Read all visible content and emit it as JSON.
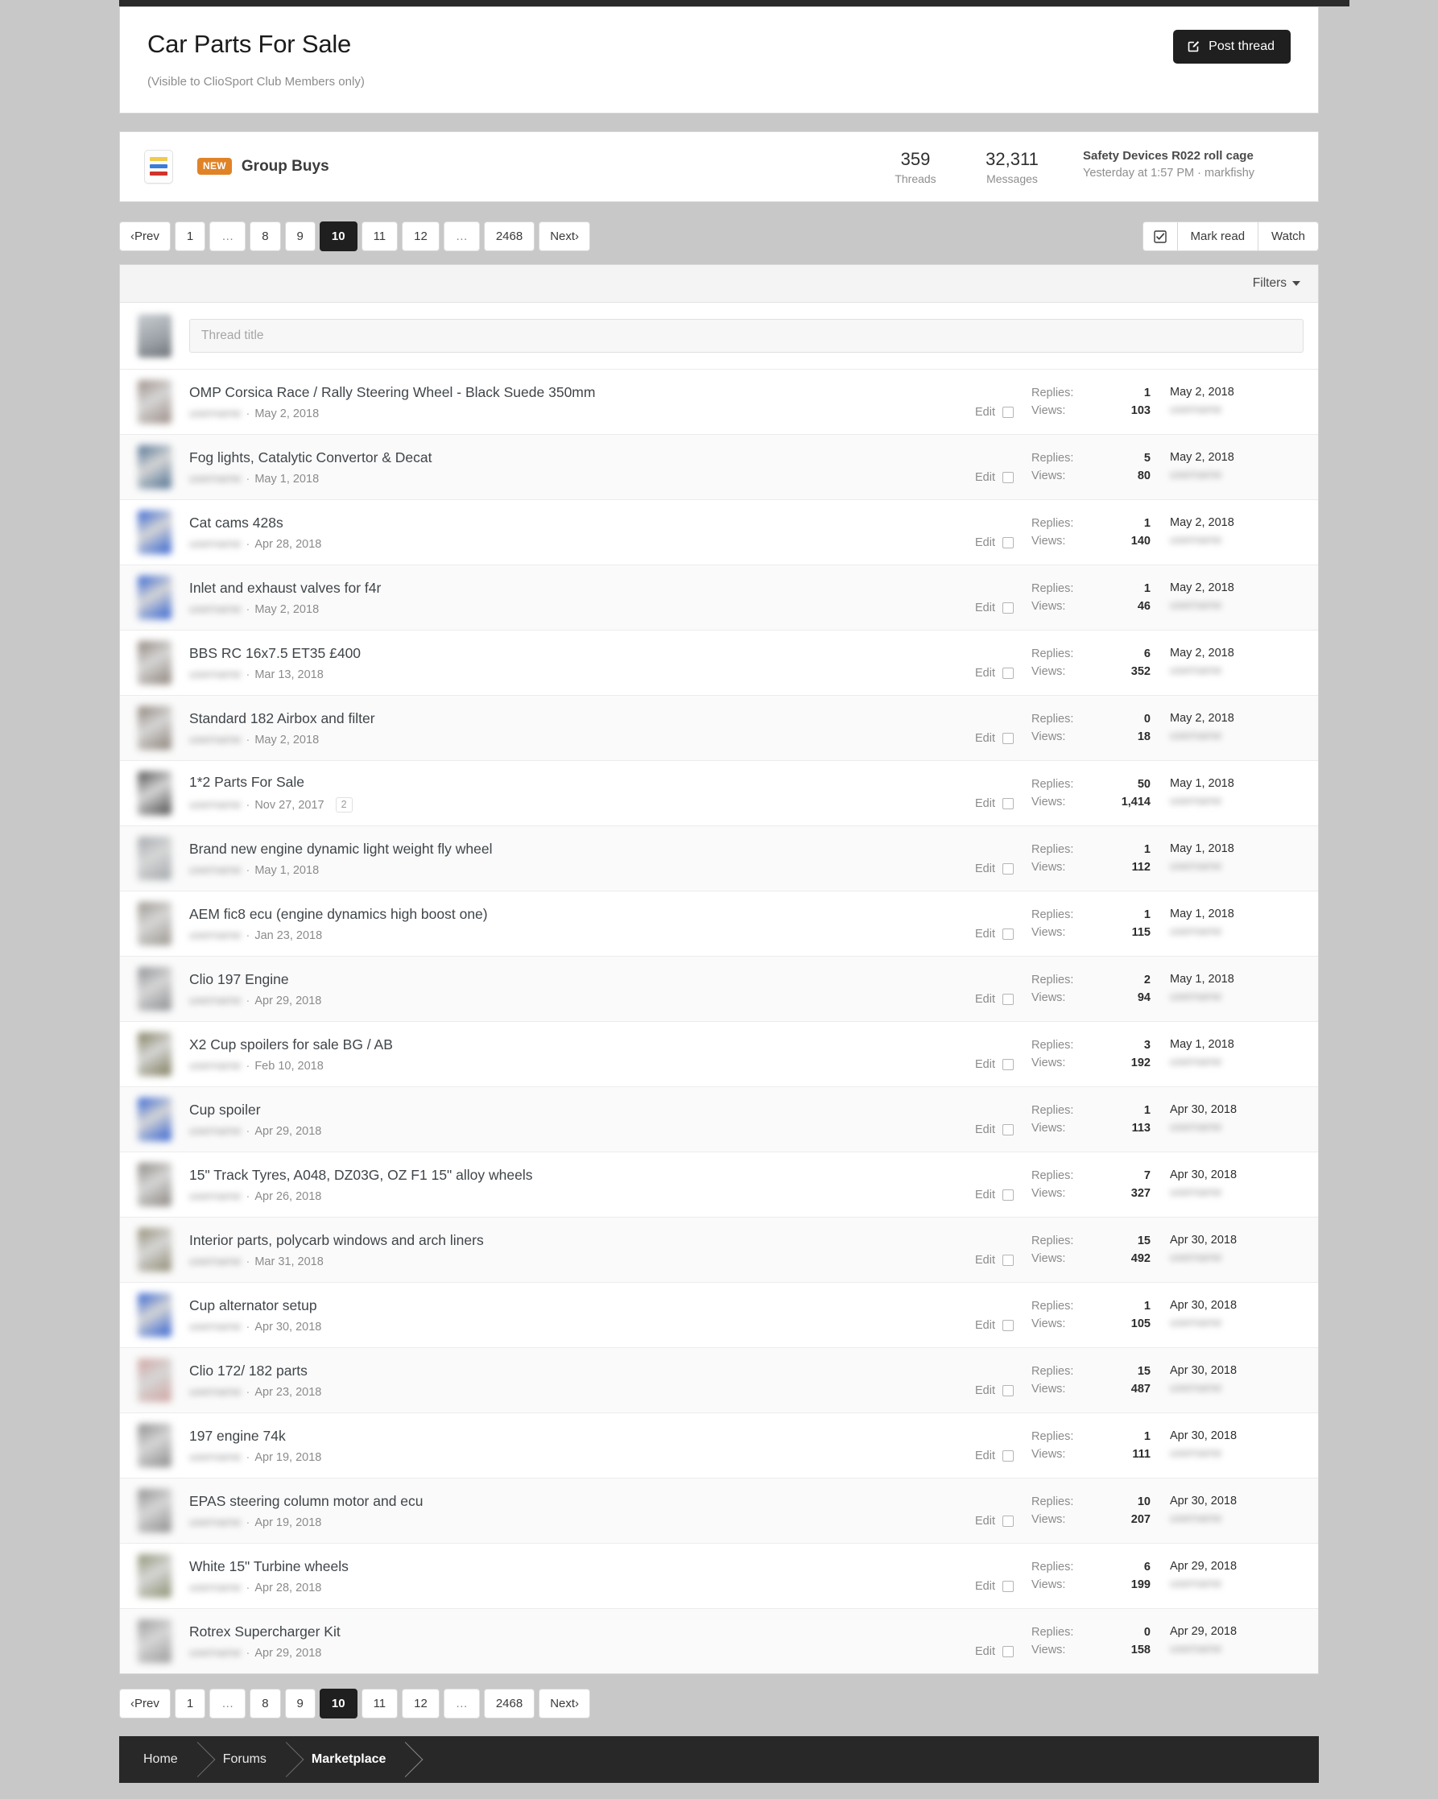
{
  "header": {
    "title": "Car Parts For Sale",
    "subtitle": "(Visible to ClioSport Club Members only)",
    "post_thread_label": "Post thread",
    "post_thread_icon": "pencil-square-icon"
  },
  "node": {
    "icon": "forum-node-icon",
    "badge": "NEW",
    "title": "Group Buys",
    "threads_count": "359",
    "threads_label": "Threads",
    "messages_count": "32,311",
    "messages_label": "Messages",
    "last_post_title": "Safety Devices R022 roll cage",
    "last_post_meta": "Yesterday at 1:57 PM · markfishy"
  },
  "pagination": {
    "prev": "‹Prev",
    "next": "Next›",
    "pages": [
      "1",
      "…",
      "8",
      "9",
      "10",
      "11",
      "12",
      "…",
      "2468"
    ],
    "current": "10"
  },
  "actions": {
    "mark_read": "Mark read",
    "watch": "Watch",
    "checkbox_icon": "checked-box-icon"
  },
  "list": {
    "filters_label": "Filters",
    "search_placeholder": "Thread title",
    "search_value": "",
    "edit_label": "Edit",
    "replies_label": "Replies:",
    "views_label": "Views:"
  },
  "threads": [
    {
      "title": "OMP Corsica Race / Rally Steering Wheel - Black Suede 350mm",
      "date": "May 2, 2018",
      "replies": "1",
      "views": "103",
      "last_date": "May 2, 2018",
      "av": "#9a8b84",
      "pages": ""
    },
    {
      "title": "Fog lights, Catalytic Convertor & Decat",
      "date": "May 1, 2018",
      "replies": "5",
      "views": "80",
      "last_date": "May 2, 2018",
      "av": "#4b6d8f",
      "pages": ""
    },
    {
      "title": "Cat cams 428s",
      "date": "Apr 28, 2018",
      "replies": "1",
      "views": "140",
      "last_date": "May 2, 2018",
      "av": "#2f5fd0",
      "pages": ""
    },
    {
      "title": "Inlet and exhaust valves for f4r",
      "date": "May 2, 2018",
      "replies": "1",
      "views": "46",
      "last_date": "May 2, 2018",
      "av": "#2f5fd0",
      "pages": ""
    },
    {
      "title": "BBS RC 16x7.5 ET35 £400",
      "date": "Mar 13, 2018",
      "replies": "6",
      "views": "352",
      "last_date": "May 2, 2018",
      "av": "#8d8279",
      "pages": ""
    },
    {
      "title": "Standard 182 Airbox and filter",
      "date": "May 2, 2018",
      "replies": "0",
      "views": "18",
      "last_date": "May 2, 2018",
      "av": "#8b8076",
      "pages": ""
    },
    {
      "title": "1*2 Parts For Sale",
      "date": "Nov 27, 2017",
      "replies": "50",
      "views": "1,414",
      "last_date": "May 1, 2018",
      "av": "#4a4a4a",
      "pages": "2"
    },
    {
      "title": "Brand new engine dynamic light weight fly wheel",
      "date": "May 1, 2018",
      "replies": "1",
      "views": "112",
      "last_date": "May 1, 2018",
      "av": "#a2a7ab",
      "pages": ""
    },
    {
      "title": "AEM fic8 ecu (engine dynamics high boost one)",
      "date": "Jan 23, 2018",
      "replies": "1",
      "views": "115",
      "last_date": "May 1, 2018",
      "av": "#9a958d",
      "pages": ""
    },
    {
      "title": "Clio 197 Engine",
      "date": "Apr 29, 2018",
      "replies": "2",
      "views": "94",
      "last_date": "May 1, 2018",
      "av": "#8a8c90",
      "pages": ""
    },
    {
      "title": "X2 Cup spoilers for sale BG / AB",
      "date": "Feb 10, 2018",
      "replies": "3",
      "views": "192",
      "last_date": "May 1, 2018",
      "av": "#7c7a58",
      "pages": ""
    },
    {
      "title": "Cup spoiler",
      "date": "Apr 29, 2018",
      "replies": "1",
      "views": "113",
      "last_date": "Apr 30, 2018",
      "av": "#2f5fd0",
      "pages": ""
    },
    {
      "title": "15\" Track Tyres, A048, DZ03G, OZ F1 15\" alloy wheels",
      "date": "Apr 26, 2018",
      "replies": "7",
      "views": "327",
      "last_date": "Apr 30, 2018",
      "av": "#8a8580",
      "pages": ""
    },
    {
      "title": "Interior parts, polycarb windows and arch liners",
      "date": "Mar 31, 2018",
      "replies": "15",
      "views": "492",
      "last_date": "Apr 30, 2018",
      "av": "#8f8a72",
      "pages": ""
    },
    {
      "title": "Cup alternator setup",
      "date": "Apr 30, 2018",
      "replies": "1",
      "views": "105",
      "last_date": "Apr 30, 2018",
      "av": "#2f5fd0",
      "pages": ""
    },
    {
      "title": "Clio 172/ 182 parts",
      "date": "Apr 23, 2018",
      "replies": "15",
      "views": "487",
      "last_date": "Apr 30, 2018",
      "av": "#cfa3a0",
      "pages": ""
    },
    {
      "title": "197 engine 74k",
      "date": "Apr 19, 2018",
      "replies": "1",
      "views": "111",
      "last_date": "Apr 30, 2018",
      "av": "#8a8a8a",
      "pages": ""
    },
    {
      "title": "EPAS steering column motor and ecu",
      "date": "Apr 19, 2018",
      "replies": "10",
      "views": "207",
      "last_date": "Apr 30, 2018",
      "av": "#8c8c8c",
      "pages": ""
    },
    {
      "title": "White 15\" Turbine wheels",
      "date": "Apr 28, 2018",
      "replies": "6",
      "views": "199",
      "last_date": "Apr 29, 2018",
      "av": "#8b9070",
      "pages": ""
    },
    {
      "title": "Rotrex Supercharger Kit",
      "date": "Apr 29, 2018",
      "replies": "0",
      "views": "158",
      "last_date": "Apr 29, 2018",
      "av": "#9a9a9a",
      "pages": ""
    }
  ],
  "breadcrumb": [
    "Home",
    "Forums",
    "Marketplace"
  ],
  "colors": {
    "accent_dark": "#1f1f1f",
    "badge_orange": "#e08327",
    "page_bg": "#c8c8c8",
    "node_bar_yellow": "#f2c94c",
    "node_bar_blue": "#3b7dd8",
    "node_bar_red": "#d0342c"
  }
}
